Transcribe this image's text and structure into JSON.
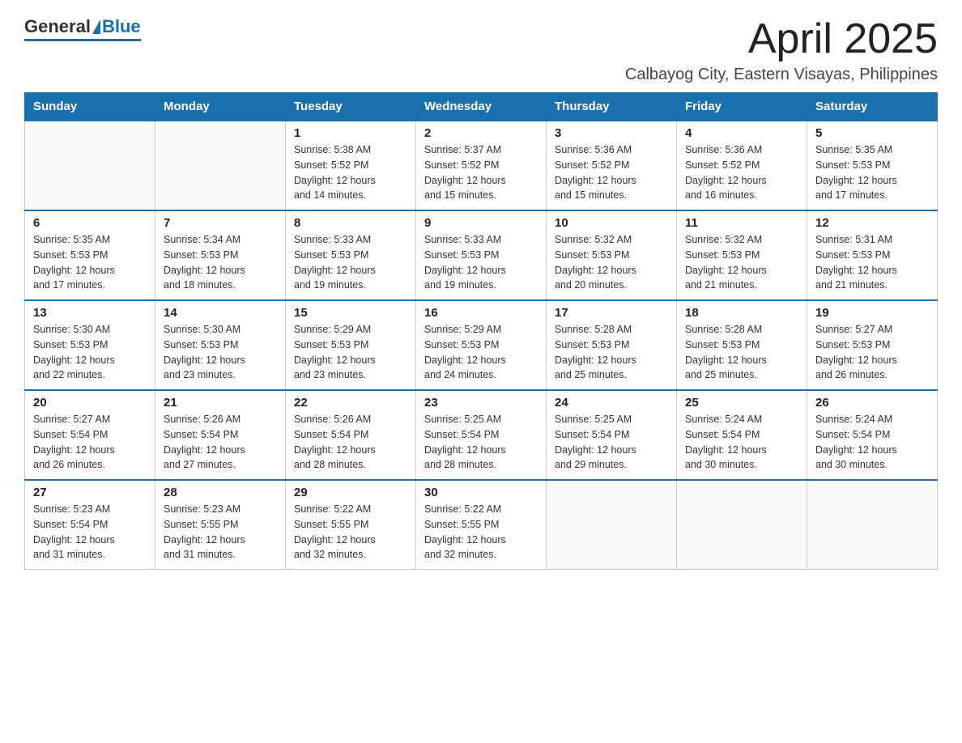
{
  "header": {
    "logo_general": "General",
    "logo_blue": "Blue",
    "month_title": "April 2025",
    "location": "Calbayog City, Eastern Visayas, Philippines"
  },
  "calendar": {
    "days_of_week": [
      "Sunday",
      "Monday",
      "Tuesday",
      "Wednesday",
      "Thursday",
      "Friday",
      "Saturday"
    ],
    "weeks": [
      [
        {
          "day": "",
          "info": ""
        },
        {
          "day": "",
          "info": ""
        },
        {
          "day": "1",
          "info": "Sunrise: 5:38 AM\nSunset: 5:52 PM\nDaylight: 12 hours\nand 14 minutes."
        },
        {
          "day": "2",
          "info": "Sunrise: 5:37 AM\nSunset: 5:52 PM\nDaylight: 12 hours\nand 15 minutes."
        },
        {
          "day": "3",
          "info": "Sunrise: 5:36 AM\nSunset: 5:52 PM\nDaylight: 12 hours\nand 15 minutes."
        },
        {
          "day": "4",
          "info": "Sunrise: 5:36 AM\nSunset: 5:52 PM\nDaylight: 12 hours\nand 16 minutes."
        },
        {
          "day": "5",
          "info": "Sunrise: 5:35 AM\nSunset: 5:53 PM\nDaylight: 12 hours\nand 17 minutes."
        }
      ],
      [
        {
          "day": "6",
          "info": "Sunrise: 5:35 AM\nSunset: 5:53 PM\nDaylight: 12 hours\nand 17 minutes."
        },
        {
          "day": "7",
          "info": "Sunrise: 5:34 AM\nSunset: 5:53 PM\nDaylight: 12 hours\nand 18 minutes."
        },
        {
          "day": "8",
          "info": "Sunrise: 5:33 AM\nSunset: 5:53 PM\nDaylight: 12 hours\nand 19 minutes."
        },
        {
          "day": "9",
          "info": "Sunrise: 5:33 AM\nSunset: 5:53 PM\nDaylight: 12 hours\nand 19 minutes."
        },
        {
          "day": "10",
          "info": "Sunrise: 5:32 AM\nSunset: 5:53 PM\nDaylight: 12 hours\nand 20 minutes."
        },
        {
          "day": "11",
          "info": "Sunrise: 5:32 AM\nSunset: 5:53 PM\nDaylight: 12 hours\nand 21 minutes."
        },
        {
          "day": "12",
          "info": "Sunrise: 5:31 AM\nSunset: 5:53 PM\nDaylight: 12 hours\nand 21 minutes."
        }
      ],
      [
        {
          "day": "13",
          "info": "Sunrise: 5:30 AM\nSunset: 5:53 PM\nDaylight: 12 hours\nand 22 minutes."
        },
        {
          "day": "14",
          "info": "Sunrise: 5:30 AM\nSunset: 5:53 PM\nDaylight: 12 hours\nand 23 minutes."
        },
        {
          "day": "15",
          "info": "Sunrise: 5:29 AM\nSunset: 5:53 PM\nDaylight: 12 hours\nand 23 minutes."
        },
        {
          "day": "16",
          "info": "Sunrise: 5:29 AM\nSunset: 5:53 PM\nDaylight: 12 hours\nand 24 minutes."
        },
        {
          "day": "17",
          "info": "Sunrise: 5:28 AM\nSunset: 5:53 PM\nDaylight: 12 hours\nand 25 minutes."
        },
        {
          "day": "18",
          "info": "Sunrise: 5:28 AM\nSunset: 5:53 PM\nDaylight: 12 hours\nand 25 minutes."
        },
        {
          "day": "19",
          "info": "Sunrise: 5:27 AM\nSunset: 5:53 PM\nDaylight: 12 hours\nand 26 minutes."
        }
      ],
      [
        {
          "day": "20",
          "info": "Sunrise: 5:27 AM\nSunset: 5:54 PM\nDaylight: 12 hours\nand 26 minutes."
        },
        {
          "day": "21",
          "info": "Sunrise: 5:26 AM\nSunset: 5:54 PM\nDaylight: 12 hours\nand 27 minutes."
        },
        {
          "day": "22",
          "info": "Sunrise: 5:26 AM\nSunset: 5:54 PM\nDaylight: 12 hours\nand 28 minutes."
        },
        {
          "day": "23",
          "info": "Sunrise: 5:25 AM\nSunset: 5:54 PM\nDaylight: 12 hours\nand 28 minutes."
        },
        {
          "day": "24",
          "info": "Sunrise: 5:25 AM\nSunset: 5:54 PM\nDaylight: 12 hours\nand 29 minutes."
        },
        {
          "day": "25",
          "info": "Sunrise: 5:24 AM\nSunset: 5:54 PM\nDaylight: 12 hours\nand 30 minutes."
        },
        {
          "day": "26",
          "info": "Sunrise: 5:24 AM\nSunset: 5:54 PM\nDaylight: 12 hours\nand 30 minutes."
        }
      ],
      [
        {
          "day": "27",
          "info": "Sunrise: 5:23 AM\nSunset: 5:54 PM\nDaylight: 12 hours\nand 31 minutes."
        },
        {
          "day": "28",
          "info": "Sunrise: 5:23 AM\nSunset: 5:55 PM\nDaylight: 12 hours\nand 31 minutes."
        },
        {
          "day": "29",
          "info": "Sunrise: 5:22 AM\nSunset: 5:55 PM\nDaylight: 12 hours\nand 32 minutes."
        },
        {
          "day": "30",
          "info": "Sunrise: 5:22 AM\nSunset: 5:55 PM\nDaylight: 12 hours\nand 32 minutes."
        },
        {
          "day": "",
          "info": ""
        },
        {
          "day": "",
          "info": ""
        },
        {
          "day": "",
          "info": ""
        }
      ]
    ]
  }
}
